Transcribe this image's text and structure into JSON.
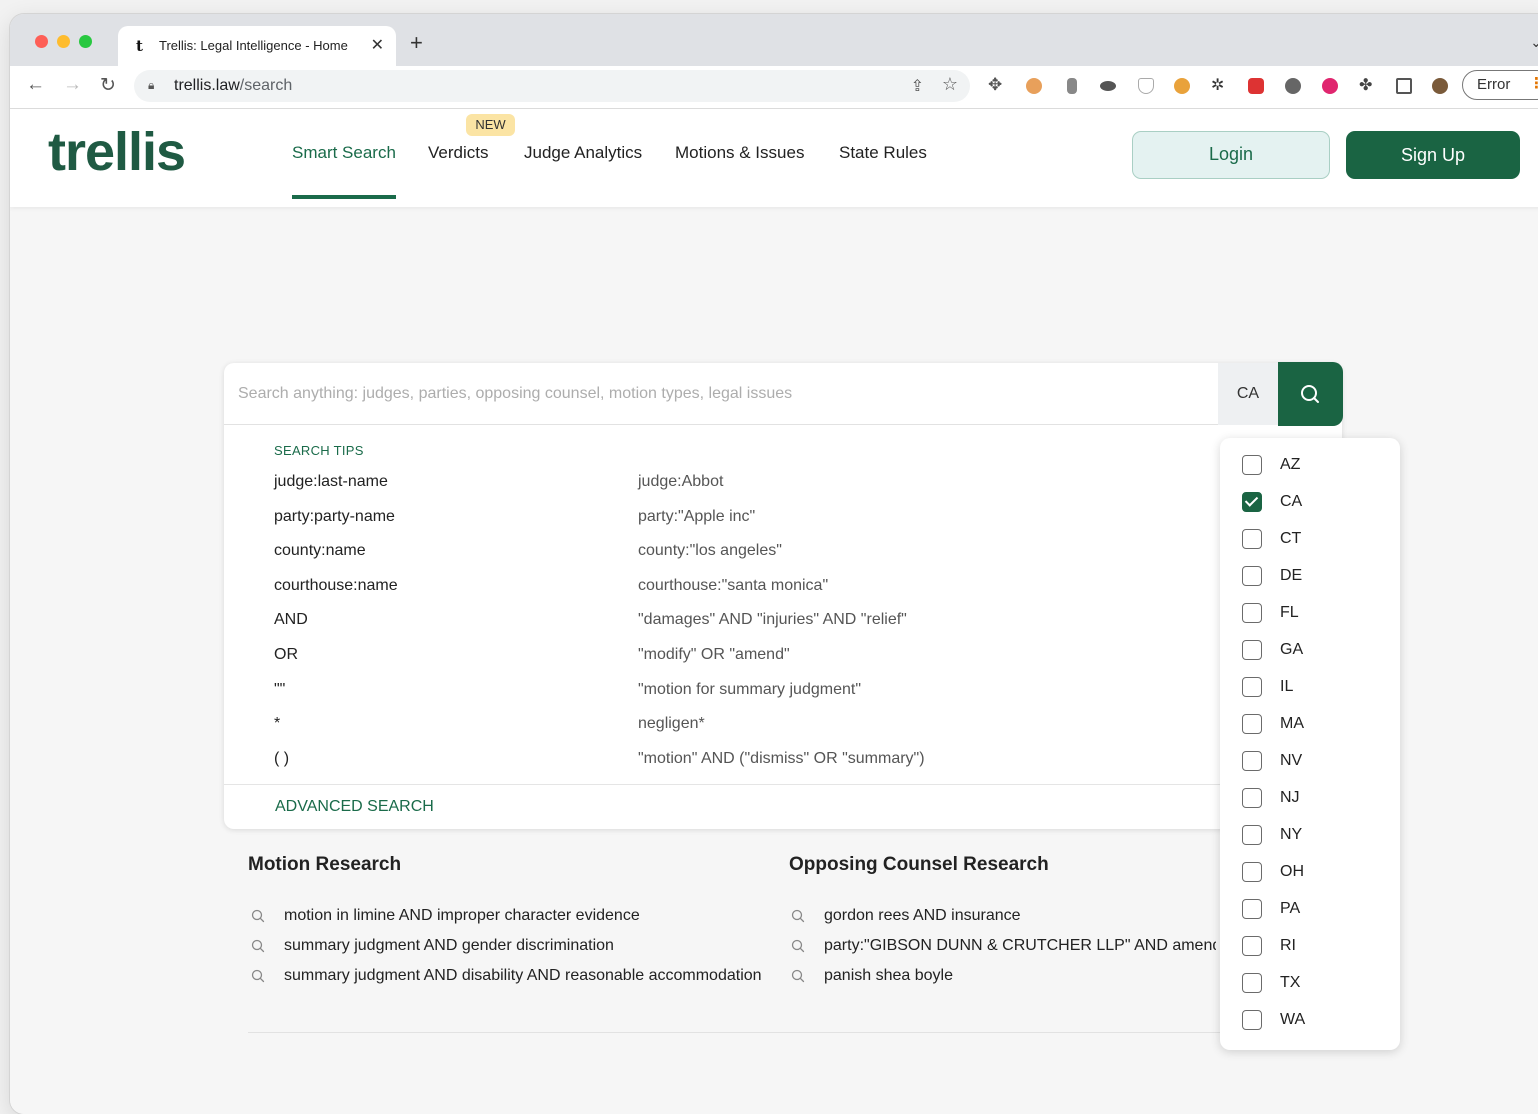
{
  "browser": {
    "tab_favicon": "t",
    "tab_title": "Trellis: Legal Intelligence - Home",
    "new_tab": "+",
    "url_domain": "trellis.law",
    "url_path": "/search",
    "error_label": "Error"
  },
  "header": {
    "logo": "trellis",
    "nav": [
      {
        "label": "Smart Search",
        "active": true
      },
      {
        "label": "Verdicts",
        "badge": "NEW"
      },
      {
        "label": "Judge Analytics"
      },
      {
        "label": "Motions & Issues"
      },
      {
        "label": "State Rules"
      }
    ],
    "login": "Login",
    "signup": "Sign Up"
  },
  "search": {
    "placeholder": "Search anything: judges, parties, opposing counsel, motion types, legal issues",
    "value": "",
    "state": "CA",
    "tips_title": "SEARCH TIPS",
    "tips": [
      {
        "syntax": "judge:last-name",
        "example": "judge:Abbot"
      },
      {
        "syntax": "party:party-name",
        "example": "party:\"Apple inc\""
      },
      {
        "syntax": "county:name",
        "example": "county:\"los angeles\""
      },
      {
        "syntax": "courthouse:name",
        "example": "courthouse:\"santa monica\""
      },
      {
        "syntax": "AND",
        "example": "\"damages\" AND \"injuries\" AND \"relief\""
      },
      {
        "syntax": "OR",
        "example": "\"modify\" OR \"amend\""
      },
      {
        "syntax": "\"\"",
        "example": "\"motion for summary judgment\""
      },
      {
        "syntax": "*",
        "example": "negligen*"
      },
      {
        "syntax": "( )",
        "example": "\"motion\" AND (\"dismiss\" OR \"summary\")"
      }
    ],
    "advanced": "ADVANCED SEARCH"
  },
  "research": {
    "motion": {
      "title": "Motion Research",
      "items": [
        "motion in limine AND improper character evidence",
        "summary judgment AND gender discrimination",
        "summary judgment AND disability AND reasonable accommodation"
      ]
    },
    "counsel": {
      "title": "Opposing Counsel Research",
      "items": [
        "gordon rees AND insurance",
        "party:\"GIBSON DUNN & CRUTCHER LLP\" AND amend c",
        "panish shea boyle"
      ]
    }
  },
  "states": [
    {
      "code": "AZ",
      "checked": false
    },
    {
      "code": "CA",
      "checked": true
    },
    {
      "code": "CT",
      "checked": false
    },
    {
      "code": "DE",
      "checked": false
    },
    {
      "code": "FL",
      "checked": false
    },
    {
      "code": "GA",
      "checked": false
    },
    {
      "code": "IL",
      "checked": false
    },
    {
      "code": "MA",
      "checked": false
    },
    {
      "code": "NV",
      "checked": false
    },
    {
      "code": "NJ",
      "checked": false
    },
    {
      "code": "NY",
      "checked": false
    },
    {
      "code": "OH",
      "checked": false
    },
    {
      "code": "PA",
      "checked": false
    },
    {
      "code": "RI",
      "checked": false
    },
    {
      "code": "TX",
      "checked": false
    },
    {
      "code": "WA",
      "checked": false
    }
  ],
  "colors": {
    "brand": "#1a6443",
    "accent": "#1a6b4a",
    "badge": "#fbe4a4"
  }
}
